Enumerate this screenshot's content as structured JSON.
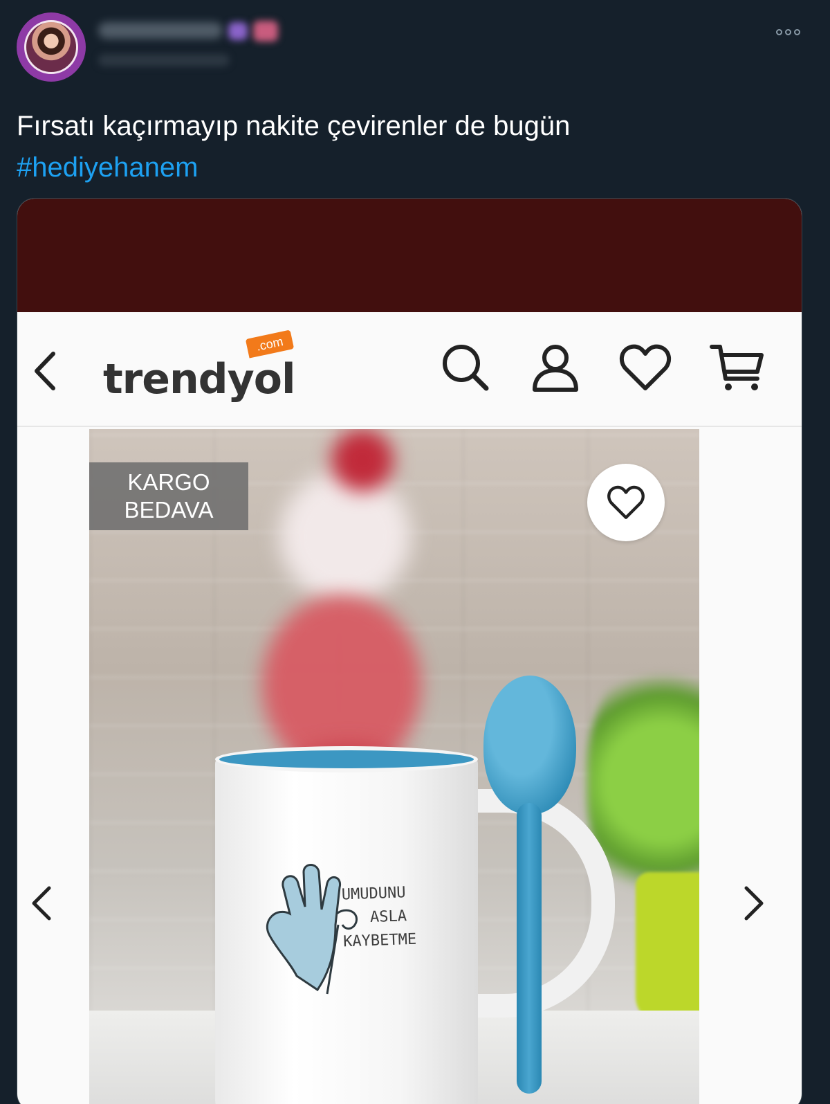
{
  "tweet": {
    "text_line1": "Fırsatı kaçırmayıp nakite çevirenler de bugün",
    "hashtag": "#hediyehanem",
    "more_icon": "more-options-icon"
  },
  "colors": {
    "background": "#15202b",
    "text": "#ffffff",
    "link": "#1da1f2",
    "status_bar": "#420f0e",
    "brand_orange": "#f27a1a",
    "avatar_ring": "#8e3aa6"
  },
  "app": {
    "logo_text": "trendyol",
    "logo_com": ".com",
    "icons": [
      "back-icon",
      "search-icon",
      "user-icon",
      "heart-icon",
      "cart-icon"
    ]
  },
  "product": {
    "badge_line1": "KARGO",
    "badge_line2": "BEDAVA",
    "mug_line1": "UMUDUNU",
    "mug_line2": "ASLA",
    "mug_line3": "KAYBETME"
  }
}
